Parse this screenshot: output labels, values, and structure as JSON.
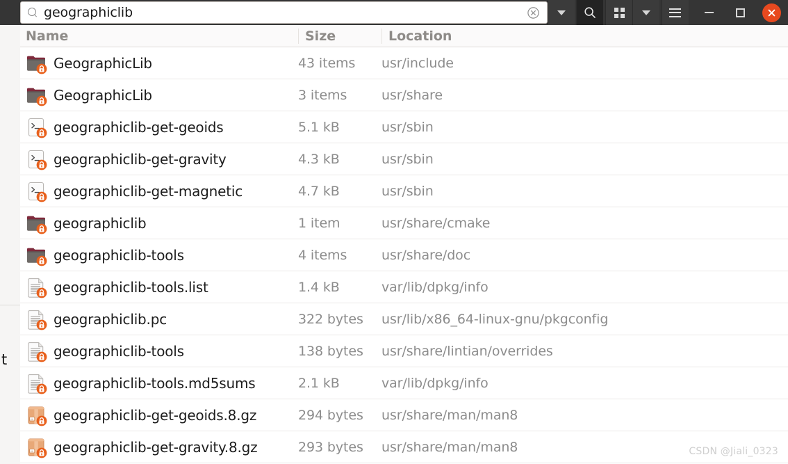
{
  "window": {
    "controls": {
      "minimize_label": "minimize",
      "maximize_label": "maximize",
      "close_label": "close"
    }
  },
  "search": {
    "value": "geographiclib",
    "placeholder": "Search",
    "search_icon": "search-icon",
    "clear_icon": "clear-icon"
  },
  "toolbar": {
    "search_dropdown_icon": "chevron-down-icon",
    "search_toggle_icon": "search-icon",
    "view_grid_icon": "grid-view-icon",
    "view_dropdown_icon": "chevron-down-icon",
    "menu_icon": "hamburger-menu-icon"
  },
  "columns": {
    "name": "Name",
    "size": "Size",
    "location": "Location"
  },
  "files": [
    {
      "icon": "folder",
      "name": "GeographicLib",
      "size": "43 items",
      "location": "usr/include"
    },
    {
      "icon": "folder",
      "name": "GeographicLib",
      "size": "3 items",
      "location": "usr/share"
    },
    {
      "icon": "script",
      "name": "geographiclib-get-geoids",
      "size": "5.1 kB",
      "location": "usr/sbin"
    },
    {
      "icon": "script",
      "name": "geographiclib-get-gravity",
      "size": "4.3 kB",
      "location": "usr/sbin"
    },
    {
      "icon": "script",
      "name": "geographiclib-get-magnetic",
      "size": "4.7 kB",
      "location": "usr/sbin"
    },
    {
      "icon": "folder",
      "name": "geographiclib",
      "size": "1 item",
      "location": "usr/share/cmake"
    },
    {
      "icon": "folder",
      "name": "geographiclib-tools",
      "size": "4 items",
      "location": "usr/share/doc"
    },
    {
      "icon": "text",
      "name": "geographiclib-tools.list",
      "size": "1.4 kB",
      "location": "var/lib/dpkg/info"
    },
    {
      "icon": "text",
      "name": "geographiclib.pc",
      "size": "322 bytes",
      "location": "usr/lib/x86_64-linux-gnu/pkgconfig"
    },
    {
      "icon": "text",
      "name": "geographiclib-tools",
      "size": "138 bytes",
      "location": "usr/share/lintian/overrides"
    },
    {
      "icon": "text",
      "name": "geographiclib-tools.md5sums",
      "size": "2.1 kB",
      "location": "var/lib/dpkg/info"
    },
    {
      "icon": "archive",
      "name": "geographiclib-get-geoids.8.gz",
      "size": "294 bytes",
      "location": "usr/share/man/man8"
    },
    {
      "icon": "archive",
      "name": "geographiclib-get-gravity.8.gz",
      "size": "293 bytes",
      "location": "usr/share/man/man8"
    }
  ],
  "background_window": {
    "partial_glyph": "t"
  },
  "watermark": {
    "text": "CSDN @Jiali_0323"
  },
  "colors": {
    "headerbar": "#353535",
    "close_button": "#e8491f",
    "lock_badge": "#e8601c",
    "folder_body": "#6e6a67",
    "folder_tab": "#7e2a3c",
    "archive_body": "#e8a877",
    "row_separator": "#ebe9e7",
    "column_header_text": "#8e8b88",
    "filename_text": "#1d1d1d",
    "meta_text": "#8c8c8c"
  }
}
